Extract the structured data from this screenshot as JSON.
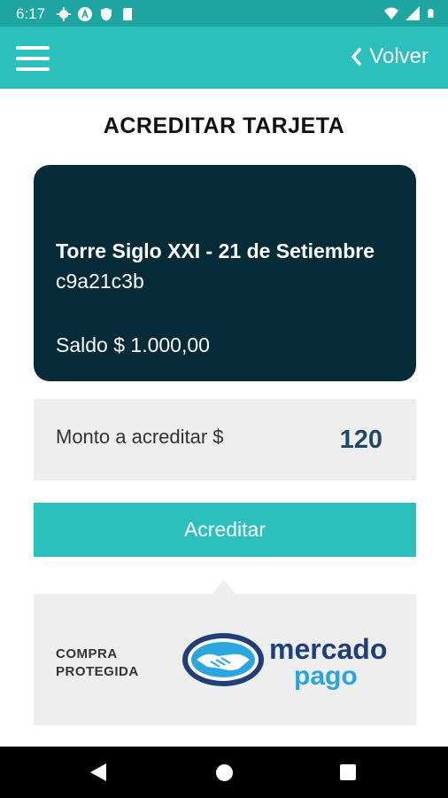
{
  "status_bar": {
    "time": "6:17",
    "icons_left": [
      "gear-icon",
      "a-circle-icon",
      "shield-icon",
      "sd-card-icon"
    ],
    "icons_right": [
      "wifi-icon",
      "signal-icon",
      "battery-icon"
    ]
  },
  "app_bar": {
    "back_label": "Volver",
    "color": "#2bbfbd"
  },
  "page": {
    "title": "ACREDITAR TARJETA"
  },
  "card": {
    "name": "Torre Siglo XXI - 21 de Setiembre",
    "code": "c9a21c3b",
    "balance": "Saldo $ 1.000,00",
    "color": "#052b39"
  },
  "amount": {
    "label": "Monto a acreditar $",
    "value": "120"
  },
  "action": {
    "button_label": "Acreditar"
  },
  "protection": {
    "line1": "COMPRA",
    "line2": "PROTEGIDA",
    "logo_word1": "mercado",
    "logo_word2": "pago",
    "logo_icon": "handshake-icon"
  },
  "nav_bar": {
    "icons": [
      "back-icon",
      "home-icon",
      "recents-icon"
    ]
  }
}
